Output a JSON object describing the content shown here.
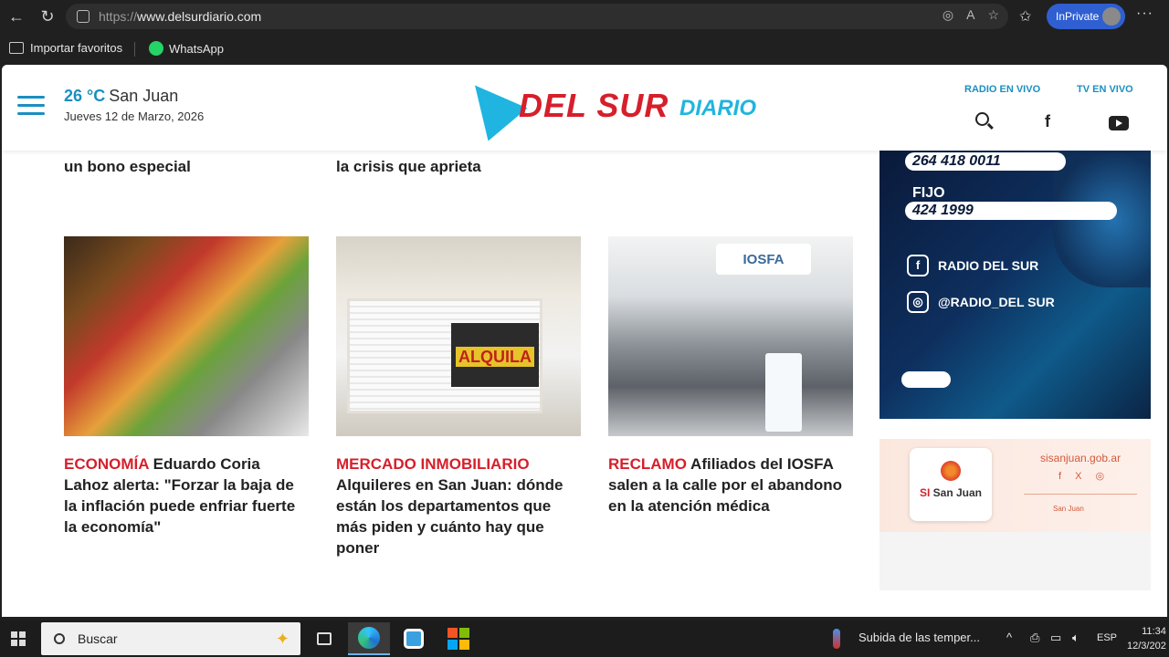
{
  "browser": {
    "url_protocol": "https://",
    "url_host": "www.delsurdiario.com",
    "inprivate_label": "InPrivate",
    "bookmarks": [
      "Importar favoritos",
      "WhatsApp"
    ]
  },
  "header": {
    "temperature": "26 °C",
    "city": "San Juan",
    "date": "Jueves 12 de Marzo, 2026",
    "logo_main": "DEL SUR",
    "logo_sub": "DIARIO",
    "radio_link": "RADIO EN VIVO",
    "tv_link": "TV EN VIVO"
  },
  "top_texts": [
    "un bono especial",
    "la crisis que aprieta"
  ],
  "articles": [
    {
      "category": "ECONOMÍA",
      "title": "Eduardo Coria Lahoz alerta: \"Forzar la baja de la inflación puede enfriar fuerte la economía\""
    },
    {
      "category": "MERCADO INMOBILIARIO",
      "title": "Alquileres en San Juan: dónde están los departamentos que más piden y cuánto hay que poner",
      "sign_text": "ALQUILA"
    },
    {
      "category": "RECLAMO",
      "title": "Afiliados del IOSFA salen a la calle por el abandono en la atención médica",
      "sign_text": "IOSFA"
    }
  ],
  "ad_radio": {
    "phone": "264 418 0011",
    "fijo_label": "FIJO",
    "fijo_number": "424 1999",
    "facebook": "RADIO DEL SUR",
    "instagram": "@RADIO_DEL SUR"
  },
  "ad_sanjuan": {
    "card_si": "SI",
    "card_name": "San Juan",
    "website": "sisanjuan.gob.ar",
    "gov_label": "San Juan"
  },
  "taskbar": {
    "search_placeholder": "Buscar",
    "weather_text": "Subida de las temper...",
    "lang": "ESP",
    "time": "11:34",
    "date": "12/3/202"
  },
  "colors": {
    "brand_red": "#d61f2b",
    "brand_blue": "#1a8fc0",
    "accent_cyan": "#1fb5e0"
  }
}
